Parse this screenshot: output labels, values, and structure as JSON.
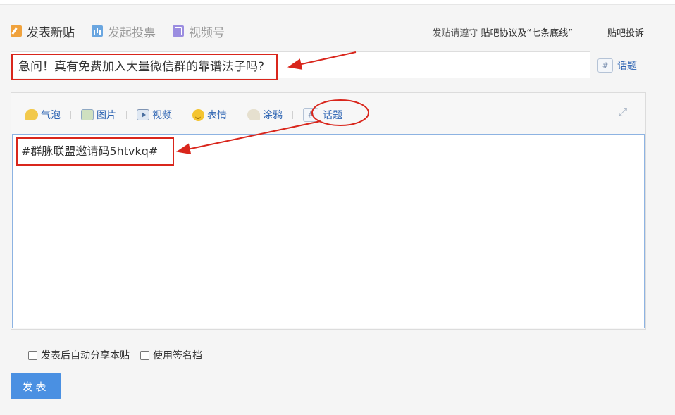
{
  "tabs": [
    {
      "label": "发表新贴",
      "icon": "edit-icon",
      "active": true
    },
    {
      "label": "发起投票",
      "icon": "vote-chart-icon",
      "active": false
    },
    {
      "label": "视频号",
      "icon": "video-account-icon",
      "active": false
    }
  ],
  "header": {
    "rules_prefix": "发贴请遵守",
    "rules_link": "贴吧协议及“七条底线”",
    "complain_link": "贴吧投诉"
  },
  "title_input": {
    "value": "急问！真有免费加入大量微信群的靠谱法子吗?"
  },
  "topic_button": {
    "label": "话题",
    "icon_glyph": "#"
  },
  "toolbar": [
    {
      "label": "气泡",
      "icon": "bubble-icon"
    },
    {
      "label": "图片",
      "icon": "image-icon"
    },
    {
      "label": "视频",
      "icon": "video-icon"
    },
    {
      "label": "表情",
      "icon": "emoji-icon"
    },
    {
      "label": "涂鸦",
      "icon": "paint-icon"
    },
    {
      "label": "话题",
      "icon": "hashtag-icon"
    }
  ],
  "editor": {
    "content": "#群脉联盟邀请码5htvkq#"
  },
  "options": [
    {
      "label": "发表后自动分享本贴",
      "checked": false
    },
    {
      "label": "使用签名档",
      "checked": false
    }
  ],
  "submit": {
    "label": "发表"
  },
  "colors": {
    "accent": "#4a90e2",
    "link": "#2d64b3",
    "annotation": "#d9261c"
  }
}
